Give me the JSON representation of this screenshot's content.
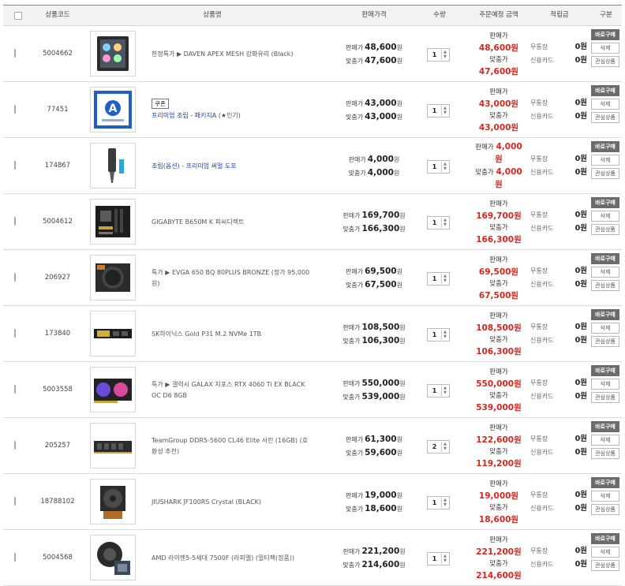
{
  "header": {
    "code": "상품코드",
    "name": "상품명",
    "price": "판매가격",
    "qty": "수량",
    "total": "주문예정 금액",
    "points": "적립금",
    "action": "구분"
  },
  "labels": {
    "sale": "판매가",
    "fit": "맞춤가",
    "won": "원",
    "point_free": "무통장",
    "point_card": "신용카드",
    "buy": "바로구매",
    "delete": "삭제",
    "wish": "관심상품",
    "coupon": "쿠폰"
  },
  "rows": [
    {
      "code": "5004662",
      "name": "한정특가 ▶ DAVEN APEX MESH 강화유리 (Black)",
      "name_style": "normal",
      "sale_price": "48,600",
      "fit_price": "47,600",
      "qty": "1",
      "total_sale": "48,600원",
      "total_fit": "47,600원",
      "pt1": "0원",
      "pt2": "0원",
      "image": "pc-case-icon"
    },
    {
      "code": "77451",
      "name": "프리미엄 조립 - 패키지A",
      "extra": " (★인기)",
      "coupon": true,
      "name_style": "blue",
      "sale_price": "43,000",
      "fit_price": "43,000",
      "qty": "1",
      "total_sale": "43,000원",
      "total_fit": "43,000원",
      "pt1": "0원",
      "pt2": "0원",
      "image": "assembly-package-icon"
    },
    {
      "code": "174867",
      "name": "조립(옵션) - 프리미엄 써멀 도포",
      "name_style": "blue",
      "sale_price": "4,000",
      "fit_price": "4,000",
      "qty": "1",
      "total_sale": "4,000",
      "total_fit": "4,000",
      "total_unit": "원",
      "inline": true,
      "pt1": "0원",
      "pt2": "0원",
      "image": "thermal-paste-icon"
    },
    {
      "code": "5004612",
      "name": "GIGABYTE B650M K 피씨디렉트",
      "name_style": "normal",
      "sale_price": "169,700",
      "fit_price": "166,300",
      "qty": "1",
      "total_sale": "169,700원",
      "total_fit": "166,300원",
      "pt1": "0원",
      "pt2": "0원",
      "image": "motherboard-icon"
    },
    {
      "code": "206927",
      "name": "특가 ▶ EVGA 650 BQ 80PLUS BRONZE (정가 95,000원)",
      "name_style": "normal",
      "sale_price": "69,500",
      "fit_price": "67,500",
      "qty": "1",
      "total_sale": "69,500원",
      "total_fit": "67,500원",
      "pt1": "0원",
      "pt2": "0원",
      "image": "power-supply-icon"
    },
    {
      "code": "173840",
      "name": "SK하이닉스 Gold P31 M.2 NVMe 1TB",
      "name_style": "normal",
      "sale_price": "108,500",
      "fit_price": "106,300",
      "qty": "1",
      "total_sale": "108,500원",
      "total_fit": "106,300원",
      "pt1": "0원",
      "pt2": "0원",
      "image": "ssd-icon"
    },
    {
      "code": "5003558",
      "name": "특가 ▶ 갤럭시 GALAX 지포스 RTX 4060 Ti EX BLACK OC D6 8GB",
      "name_style": "normal",
      "sale_price": "550,000",
      "fit_price": "539,000",
      "qty": "1",
      "total_sale": "550,000원",
      "total_fit": "539,000원",
      "pt1": "0원",
      "pt2": "0원",
      "image": "graphics-card-icon"
    },
    {
      "code": "205257",
      "name": "TeamGroup DDR5-5600 CL46 Elite 서린 (16GB) (호환성 추천)",
      "name_style": "normal",
      "sale_price": "61,300",
      "fit_price": "59,600",
      "qty": "2",
      "total_sale": "122,600원",
      "total_fit": "119,200원",
      "pt1": "0원",
      "pt2": "0원",
      "image": "ram-icon"
    },
    {
      "code": "18788102",
      "name": "JIUSHARK JF100RS Crystal (BLACK)",
      "name_style": "normal",
      "sale_price": "19,000",
      "fit_price": "18,600",
      "qty": "1",
      "total_sale": "19,000원",
      "total_fit": "18,600원",
      "pt1": "0원",
      "pt2": "0원",
      "image": "cpu-cooler-icon"
    },
    {
      "code": "5004568",
      "name": "AMD 라이젠5-5세대 7500F (라피엘) (멀티팩(정품))",
      "name_style": "normal",
      "sale_price": "221,200",
      "fit_price": "214,600",
      "qty": "1",
      "total_sale": "221,200원",
      "total_fit": "214,600원",
      "pt1": "0원",
      "pt2": "0원",
      "image": "cpu-icon"
    }
  ]
}
